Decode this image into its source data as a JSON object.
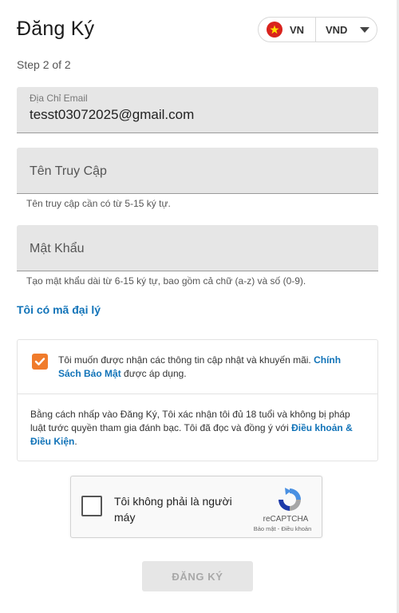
{
  "header": {
    "title": "Đăng Ký",
    "language": "VN",
    "currency": "VND",
    "flag_icon": "vietnam-flag-icon"
  },
  "step": "Step 2 of 2",
  "email": {
    "label": "Địa Chỉ Email",
    "value": "tesst03072025@gmail.com"
  },
  "username": {
    "placeholder": "Tên Truy Cập",
    "hint": "Tên truy cập cần có từ 5-15 ký tự."
  },
  "password": {
    "placeholder": "Mật Khẩu",
    "hint": "Tạo mật khẩu dài từ 6-15 ký tự, bao gồm cả chữ (a-z) và số (0-9)."
  },
  "agent_link": "Tôi có mã đại lý",
  "consent": {
    "checked": true,
    "text": "Tôi muốn được nhận các thông tin cập nhật và khuyến mãi. ",
    "link": "Chính Sách Bảo Mật",
    "suffix": " được áp dụng."
  },
  "terms": {
    "text": "Bằng cách nhấp vào Đăng Ký, Tôi xác nhận tôi đủ 18 tuổi và không bị pháp luật tước quyền tham gia đánh bạc. Tôi đã đọc và đồng ý với ",
    "link": "Điều khoản & Điều Kiện",
    "suffix": "."
  },
  "captcha": {
    "label": "Tôi không phải là người máy",
    "brand": "reCAPTCHA",
    "links": "Bảo mật - Điều khoản"
  },
  "submit_label": "ĐĂNG KÝ",
  "colors": {
    "accent": "#f07b2b",
    "link": "#1173b8",
    "field_bg": "#e6e6e6"
  }
}
